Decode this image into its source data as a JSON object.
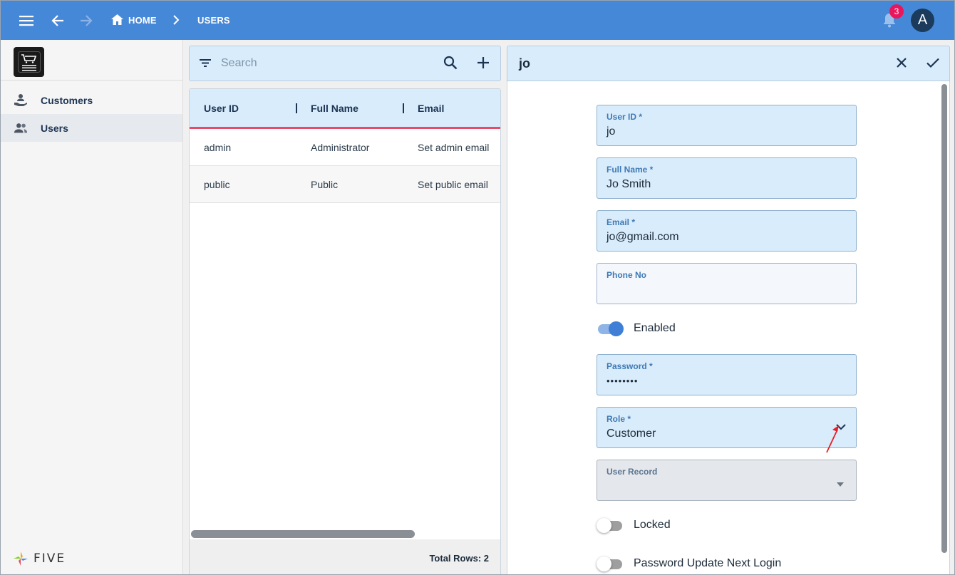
{
  "topbar": {
    "crumbs": [
      "HOME",
      "USERS"
    ],
    "notification_count": "3",
    "avatar_initial": "A"
  },
  "sidebar": {
    "items": [
      {
        "label": "Customers",
        "icon": "customer-hand-icon",
        "active": false
      },
      {
        "label": "Users",
        "icon": "users-group-icon",
        "active": true
      }
    ],
    "brand": "FIVE"
  },
  "list": {
    "search_placeholder": "Search",
    "columns": [
      "User ID",
      "Full Name",
      "Email"
    ],
    "rows": [
      [
        "admin",
        "Administrator",
        "Set admin email"
      ],
      [
        "public",
        "Public",
        "Set public email"
      ]
    ],
    "total_rows": "Total Rows: 2"
  },
  "form": {
    "title": "jo",
    "user_id": {
      "label": "User ID *",
      "value": "jo"
    },
    "full_name": {
      "label": "Full Name *",
      "value": "Jo Smith"
    },
    "email": {
      "label": "Email *",
      "value": "jo@gmail.com"
    },
    "phone": {
      "label": "Phone No",
      "value": ""
    },
    "enabled": {
      "label": "Enabled",
      "on": true
    },
    "password": {
      "label": "Password *",
      "value": "••••••••"
    },
    "role": {
      "label": "Role *",
      "value": "Customer"
    },
    "user_record": {
      "label": "User Record",
      "value": ""
    },
    "locked": {
      "label": "Locked",
      "on": false
    },
    "password_update": {
      "label": "Password Update Next Login",
      "on": false
    }
  },
  "colors": {
    "topbar": "#4688d8",
    "accent_red": "#e94b64",
    "field_bg": "#d9ecfb",
    "badge": "#e8175d"
  }
}
